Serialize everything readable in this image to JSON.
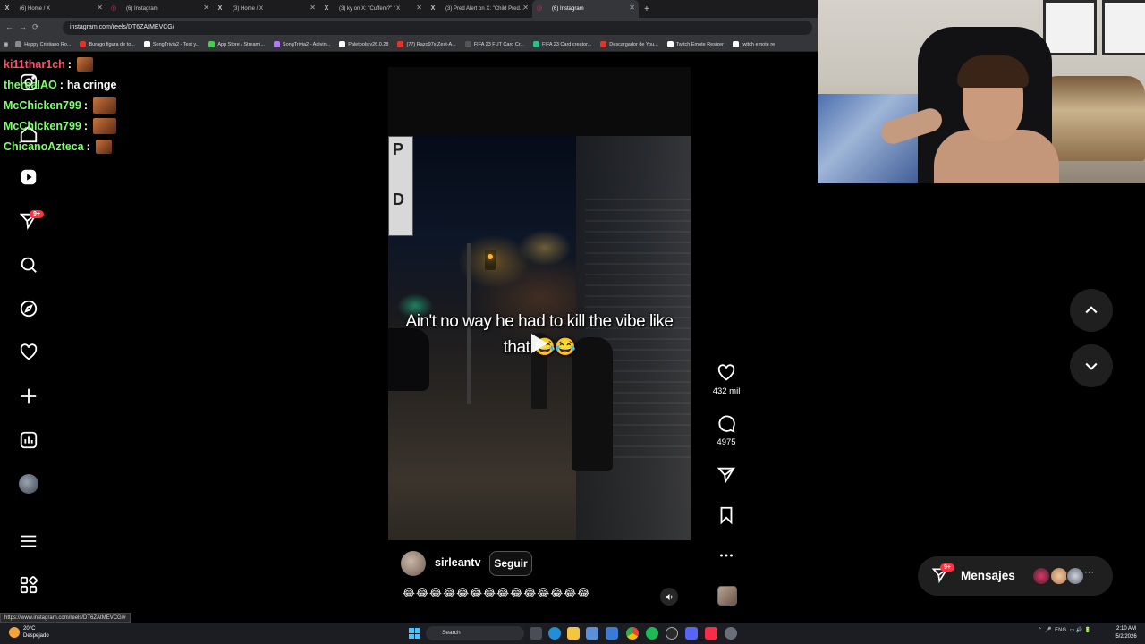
{
  "browser": {
    "tabs": [
      {
        "label": "(6) Home / X",
        "icon": "x-icon",
        "active": false
      },
      {
        "label": "(6) Instagram",
        "icon": "instagram-icon",
        "active": false
      },
      {
        "label": "(3) Home / X",
        "icon": "x-icon",
        "active": false
      },
      {
        "label": "(3) ky on X: \"Cuffem?\" / X",
        "icon": "x-icon",
        "active": false
      },
      {
        "label": "(3) Pred Alert on X: \"Child Pred...",
        "icon": "x-icon",
        "active": false
      },
      {
        "label": "(6) Instagram",
        "icon": "instagram-icon",
        "active": true
      }
    ],
    "new_tab": "+",
    "url": "instagram.com/reels/DT6ZAtMEVCG/",
    "bookmarks": [
      {
        "label": "Happy Cristiano Ro...",
        "color": "#8a8a8a"
      },
      {
        "label": "Burago figura de to...",
        "color": "#e5332a"
      },
      {
        "label": "SongTrivia2 - Test y...",
        "color": "#ffffff"
      },
      {
        "label": "App Store / Streami...",
        "color": "#3fd14c"
      },
      {
        "label": "SongTrivia2 - Adivin...",
        "color": "#b07cf0"
      },
      {
        "label": "Paletools v26.0.28",
        "color": "#ffffff"
      },
      {
        "label": "(77) Razo97s Zest-A...",
        "color": "#e5332a"
      },
      {
        "label": "FIFA 23 FUT Card Cr...",
        "color": "#555555"
      },
      {
        "label": "FIFA 23 Card creator...",
        "color": "#2bbf8a"
      },
      {
        "label": "Descargador de You...",
        "color": "#e5332a"
      },
      {
        "label": "Twitch Emote Resizer",
        "color": "#ffffff"
      },
      {
        "label": "twitch emote re",
        "color": "#ffffff"
      }
    ]
  },
  "chat": [
    {
      "user": "ki11thar1ch",
      "color": "#ff4d6d",
      "msg": ""
    },
    {
      "user": "thereaIAO",
      "color": "#7dff6a",
      "msg": "ha cringe"
    },
    {
      "user": "McChicken799",
      "color": "#7dff6a",
      "msg": ""
    },
    {
      "user": "McChicken799",
      "color": "#7dff6a",
      "msg": ""
    },
    {
      "user": "ChicanoAzteca",
      "color": "#7dff6a",
      "msg": ""
    }
  ],
  "nav": {
    "messages_badge": "9+"
  },
  "reel": {
    "caption": "Ain't no way he had to kill the vibe like that 😂😂",
    "author": "sirleantv",
    "follow_label": "Seguir",
    "emojis": "😂😂😂😂😂😂😂😂😂😂😂😂😂😂",
    "likes": "432 mil",
    "comments": "4975"
  },
  "messages": {
    "label": "Mensajes",
    "badge": "9+",
    "more": "···"
  },
  "status_url": "https://www.instagram.com/reels/DT6ZAtMEVCG/#",
  "taskbar": {
    "weather_temp": "20°C",
    "weather_desc": "Despejado",
    "search_placeholder": "Search",
    "lang": "ENG",
    "time": "2:10 AM",
    "date": "5/2/2026"
  }
}
